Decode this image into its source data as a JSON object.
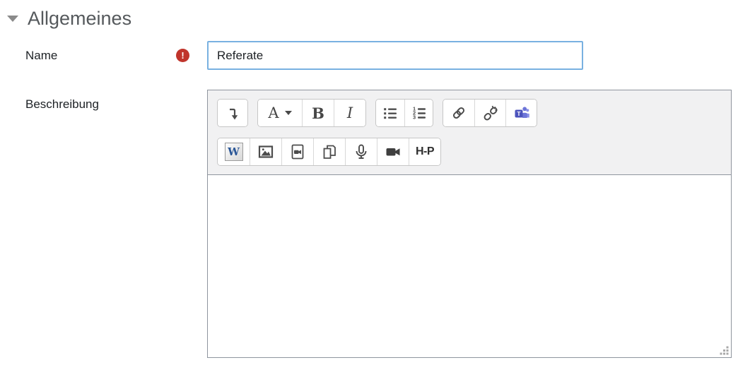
{
  "section": {
    "title": "Allgemeines",
    "collapse_icon": "triangle-down"
  },
  "form": {
    "name_label": "Name",
    "name_required": true,
    "name_value": "Referate",
    "description_label": "Beschreibung",
    "description_value": ""
  },
  "editor_toolbar": {
    "font_button_letter": "A",
    "bold_letter": "B",
    "italic_letter": "I",
    "ordered_digits": [
      "1",
      "2",
      "3"
    ],
    "word_letter": "W",
    "h5p_label": "H-P",
    "row1_buttons": [
      "collapse-toolbar",
      "font-style",
      "bold",
      "italic",
      "unordered-list",
      "ordered-list",
      "link",
      "unlink",
      "teams-meeting"
    ],
    "row2_buttons": [
      "word-import",
      "insert-image",
      "insert-media",
      "manage-files",
      "record-audio",
      "record-video",
      "h5p"
    ]
  },
  "colors": {
    "section_title": "#55595c",
    "input_border_focus": "#79b1e1",
    "required_red": "#c0342b",
    "toolbar_bg": "#f1f1f2",
    "editor_border": "#8f959e",
    "button_border": "#c6c6c6",
    "icon_gray": "#4c4c4c",
    "teams_purple": "#4b53bc",
    "teams_purple_light": "#7b83eb",
    "word_blue": "#2b5797"
  }
}
